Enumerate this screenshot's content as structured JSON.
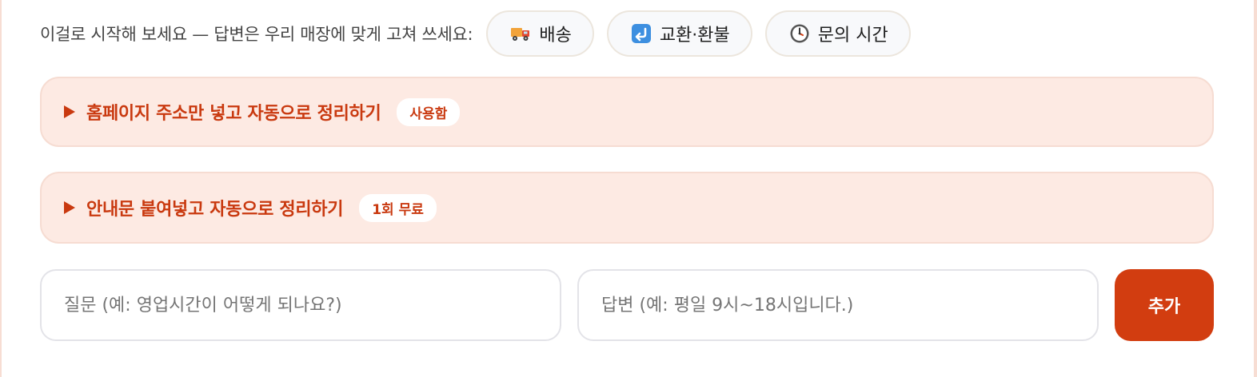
{
  "starter": {
    "hint": "이걸로 시작해 보세요 — 답변은 우리 매장에 맞게 고쳐 쓰세요:",
    "chips": [
      {
        "label": "배송",
        "icon": "delivery-truck-icon"
      },
      {
        "label": "교환·환불",
        "icon": "return-arrow-icon"
      },
      {
        "label": "문의 시간",
        "icon": "clock-icon"
      }
    ]
  },
  "panels": [
    {
      "title": "홈페이지 주소만 넣고 자동으로 정리하기",
      "badge": "사용함",
      "icon": "expand-triangle-icon"
    },
    {
      "title": "안내문 붙여넣고 자동으로 정리하기",
      "badge": "1회 무료",
      "icon": "expand-triangle-icon"
    }
  ],
  "form": {
    "question_placeholder": "질문 (예: 영업시간이 어떻게 되나요?)",
    "question_value": "",
    "answer_placeholder": "답변 (예: 평일 9시~18시입니다.)",
    "answer_value": "",
    "add_label": "추가"
  },
  "colors": {
    "accent": "#d23d10",
    "accent_text": "#c9390f",
    "panel_bg": "#fdeae3",
    "chip_bg": "#f8f9fb"
  }
}
